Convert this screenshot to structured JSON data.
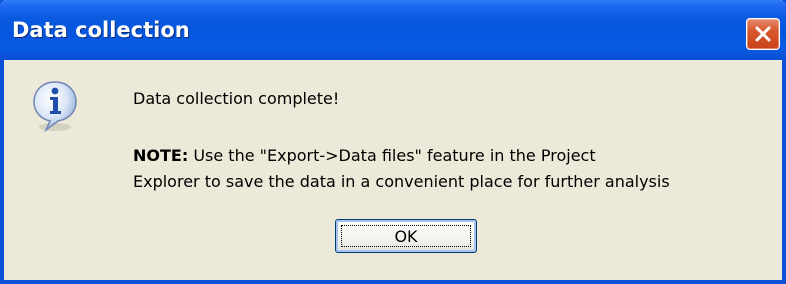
{
  "window": {
    "title": "Data collection",
    "close_icon": "close-icon",
    "title_bar_color": "#0a5ae0",
    "close_button_color": "#d8582d",
    "body_color": "#ece9d8"
  },
  "dialog": {
    "icon": "info-icon",
    "message": "Data collection complete!",
    "note_label": "NOTE:",
    "note_text": " Use the \"Export->Data files\" feature in the Project",
    "note_text_line2": "Explorer to save the data in a convenient place for further analysis"
  },
  "buttons": {
    "ok_label": "OK"
  }
}
